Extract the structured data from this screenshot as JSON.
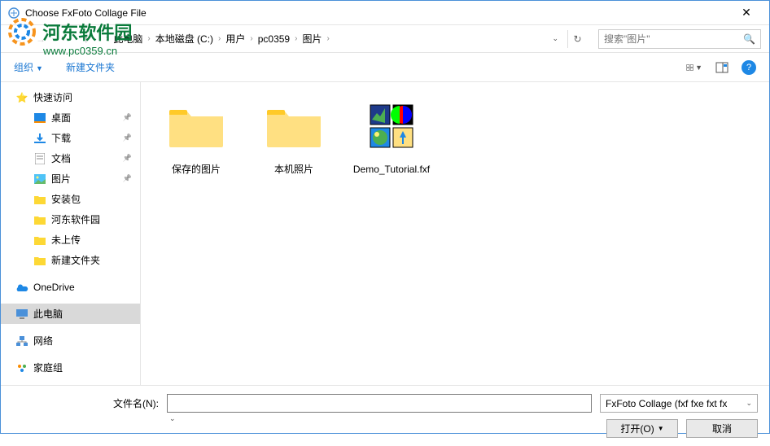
{
  "window": {
    "title": "Choose FxFoto Collage File"
  },
  "watermark": {
    "line1": "河东软件园",
    "line2": "www.pc0359.cn"
  },
  "nav": {
    "crumbs": [
      "此电脑",
      "本地磁盘 (C:)",
      "用户",
      "pc0359",
      "图片"
    ],
    "search_placeholder": "搜索\"图片\""
  },
  "toolbar": {
    "organize": "组织",
    "newfolder": "新建文件夹"
  },
  "sidebar": {
    "quick": "快速访问",
    "desktop": "桌面",
    "downloads": "下载",
    "documents": "文档",
    "pictures": "图片",
    "pkg": "安装包",
    "hedong": "河东软件园",
    "unupload": "未上传",
    "newfolder": "新建文件夹",
    "onedrive": "OneDrive",
    "thispc": "此电脑",
    "network": "网络",
    "homegroup": "家庭组"
  },
  "files": {
    "f1": "保存的图片",
    "f2": "本机照片",
    "f3": "Demo_Tutorial.fxf"
  },
  "footer": {
    "filename_label": "文件名(N):",
    "filetype": "FxFoto Collage  (fxf fxe fxt fx",
    "open": "打开(O)",
    "cancel": "取消"
  }
}
